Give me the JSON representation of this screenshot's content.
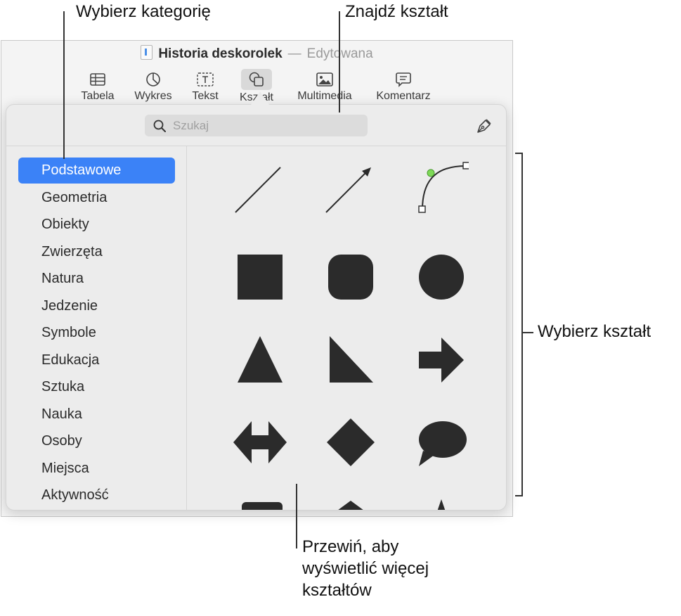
{
  "callouts": {
    "choose_category": "Wybierz kategorię",
    "find_shape": "Znajdź kształt",
    "choose_shape": "Wybierz kształt",
    "scroll_line1": "Przewiń, aby",
    "scroll_line2": "wyświetlić więcej",
    "scroll_line3": "kształtów"
  },
  "window": {
    "doc_title": "Historia deskorolek",
    "separator": "—",
    "doc_status": "Edytowana"
  },
  "toolbar": {
    "items": [
      {
        "label": "Tabela",
        "icon": "table-icon"
      },
      {
        "label": "Wykres",
        "icon": "chart-icon"
      },
      {
        "label": "Tekst",
        "icon": "text-box-icon"
      },
      {
        "label": "Kształt",
        "icon": "shape-icon",
        "active": true
      },
      {
        "label": "Multimedia",
        "icon": "media-icon"
      },
      {
        "label": "Komentarz",
        "icon": "comment-icon"
      }
    ]
  },
  "search": {
    "placeholder": "Szukaj"
  },
  "categories": [
    "Podstawowe",
    "Geometria",
    "Obiekty",
    "Zwierzęta",
    "Natura",
    "Jedzenie",
    "Symbole",
    "Edukacja",
    "Sztuka",
    "Nauka",
    "Osoby",
    "Miejsca",
    "Aktywność"
  ],
  "selected_category": "Podstawowe",
  "shapes": [
    "line",
    "arrow-line",
    "curve",
    "square",
    "rounded-square",
    "circle",
    "triangle",
    "right-triangle",
    "arrow-right",
    "double-arrow",
    "diamond",
    "speech-bubble",
    "callout-square",
    "pentagon",
    "star"
  ],
  "colors": {
    "accent": "#3b82f7",
    "shape_fill": "#2b2b2b",
    "curve_point": "#7ed957"
  }
}
